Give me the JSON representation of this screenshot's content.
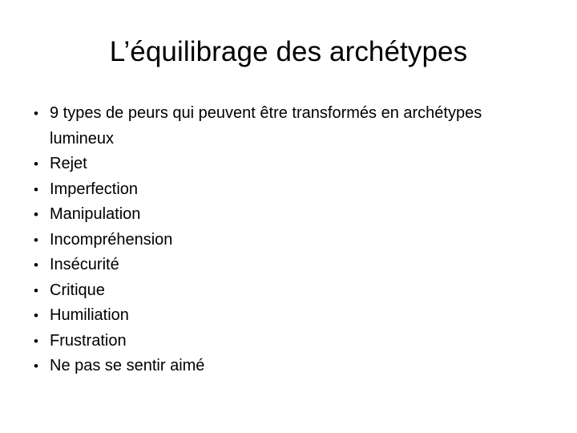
{
  "slide": {
    "title": "L’équilibrage des archétypes",
    "bullet_marker": "•",
    "text_color": "#000000",
    "background_color": "#ffffff",
    "bullets": [
      {
        "text": "9 types de peurs qui peuvent être transformés en archétypes lumineux"
      },
      {
        "text": "Rejet"
      },
      {
        "text": "Imperfection"
      },
      {
        "text": "Manipulation"
      },
      {
        "text": "Incompréhension"
      },
      {
        "text": "Insécurité"
      },
      {
        "text": "Critique"
      },
      {
        "text": "Humiliation"
      },
      {
        "text": "Frustration"
      },
      {
        "text": "Ne pas se sentir aimé"
      }
    ]
  }
}
